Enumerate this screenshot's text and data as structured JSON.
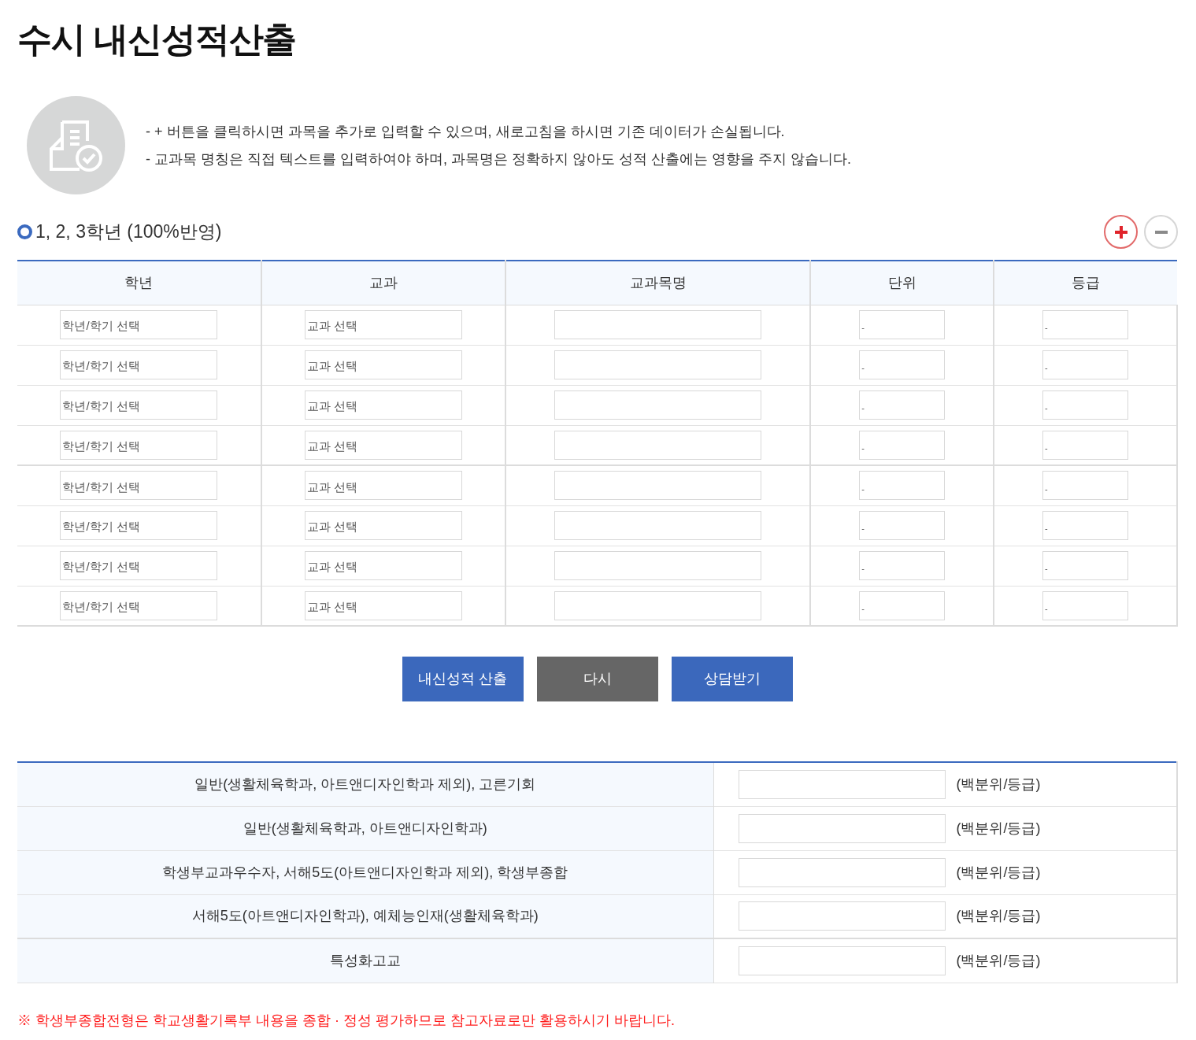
{
  "title": "수시 내신성적산출",
  "notes": [
    "- + 버튼을 클릭하시면 과목을 추가로 입력할 수 있으며, 새로고침을 하시면 기존 데이터가 손실됩니다.",
    "- 교과목 명칭은 직접 텍스트를 입력하여야 하며, 과목명은 정확하지 않아도 성적 산출에는 영향을 주지 않습니다."
  ],
  "section_title": "1, 2, 3학년 (100%반영)",
  "table": {
    "columns": [
      "학년",
      "교과",
      "교과목명",
      "단위",
      "등급"
    ],
    "rows": [
      {
        "grade_semester": "학년/학기 선택",
        "subject": "교과 선택",
        "unit": "-",
        "grade": "-"
      },
      {
        "grade_semester": "학년/학기 선택",
        "subject": "교과 선택",
        "unit": "-",
        "grade": "-"
      },
      {
        "grade_semester": "학년/학기 선택",
        "subject": "교과 선택",
        "unit": "-",
        "grade": "-"
      },
      {
        "grade_semester": "학년/학기 선택",
        "subject": "교과 선택",
        "unit": "-",
        "grade": "-"
      },
      {
        "grade_semester": "학년/학기 선택",
        "subject": "교과 선택",
        "unit": "-",
        "grade": "-"
      },
      {
        "grade_semester": "학년/학기 선택",
        "subject": "교과 선택",
        "unit": "-",
        "grade": "-"
      },
      {
        "grade_semester": "학년/학기 선택",
        "subject": "교과 선택",
        "unit": "-",
        "grade": "-"
      },
      {
        "grade_semester": "학년/학기 선택",
        "subject": "교과 선택",
        "unit": "-",
        "grade": "-"
      }
    ]
  },
  "buttons": [
    {
      "label": "내신성적 산출",
      "kind": "primary"
    },
    {
      "label": "다시",
      "kind": "secondary"
    },
    {
      "label": "상담받기",
      "kind": "primary"
    }
  ],
  "results": [
    {
      "label": "일반(생활체육학과, 아트앤디자인학과 제외), 고른기회",
      "unit": "(백분위/등급)"
    },
    {
      "label": "일반(생활체육학과, 아트앤디자인학과)",
      "unit": "(백분위/등급)"
    },
    {
      "label": "학생부교과우수자, 서해5도(아트앤디자인학과 제외), 학생부종합",
      "unit": "(백분위/등급)"
    },
    {
      "label": "서해5도(아트앤디자인학과), 예체능인재(생활체육학과)",
      "unit": "(백분위/등급)"
    },
    {
      "label": "특성화고교",
      "unit": "(백분위/등급)"
    }
  ],
  "footnote": "※ 학생부종합전형은 학교생활기록부 내용을 종합 · 정성 평가하므로 참고자료로만 활용하시기 바랍니다."
}
